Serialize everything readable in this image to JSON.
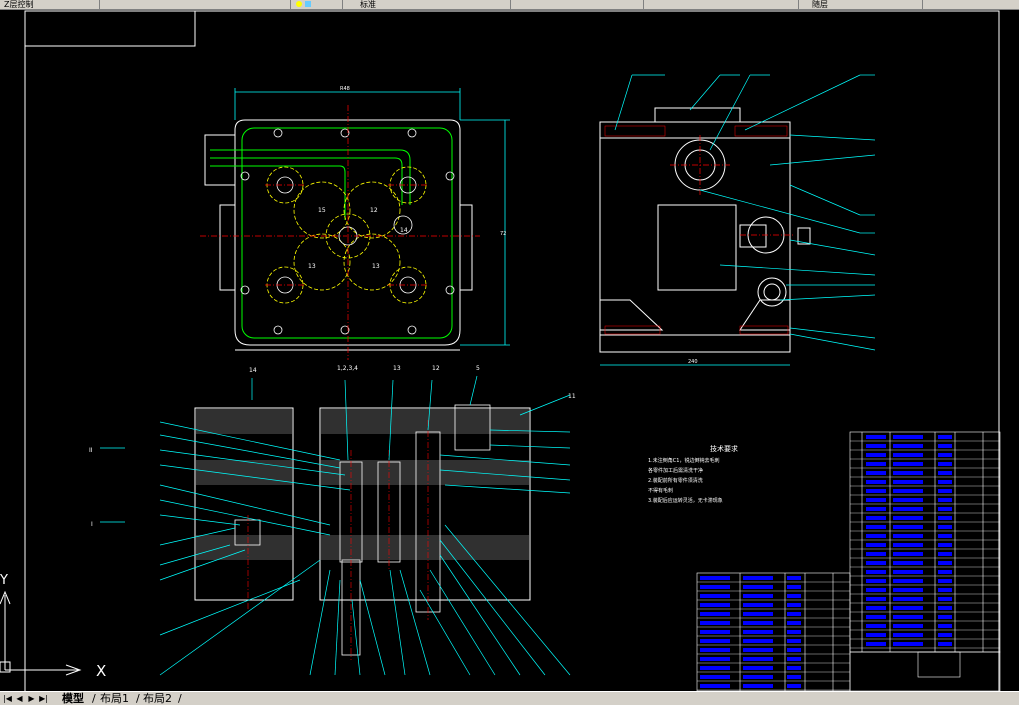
{
  "toolbar": {
    "layer_name": "Z层控制",
    "style_label": "标准",
    "color_label": "随层"
  },
  "ucs": {
    "x_label": "X",
    "y_label": "Y"
  },
  "drawing": {
    "top_dim": "R48",
    "side_dim": "72",
    "section_labels": [
      "14",
      "1,2,3,4",
      "13",
      "12",
      "5",
      "11"
    ],
    "left_markers": [
      "II",
      "I"
    ],
    "gear_labels": [
      "15",
      "12",
      "14",
      "13",
      "13"
    ],
    "tech_title": "技术要求",
    "tech_lines": [
      "1.未注倒角C1，锐边倒钝去毛刺",
      "  各零件加工后需清洗干净",
      "2.装配前所有零件须清洗",
      "  不得有毛刺",
      "3.装配后应运转灵活，无卡滞现象"
    ],
    "right_view_dim": "240"
  },
  "tabs": {
    "model": "模型",
    "layout1": "布局1",
    "layout2": "布局2"
  },
  "colors": {
    "background": "#000000",
    "cyan": "#00ffff",
    "white": "#ffffff",
    "yellow": "#ffff00",
    "green": "#00ff00",
    "red": "#ff0000",
    "blue": "#0000ff"
  }
}
